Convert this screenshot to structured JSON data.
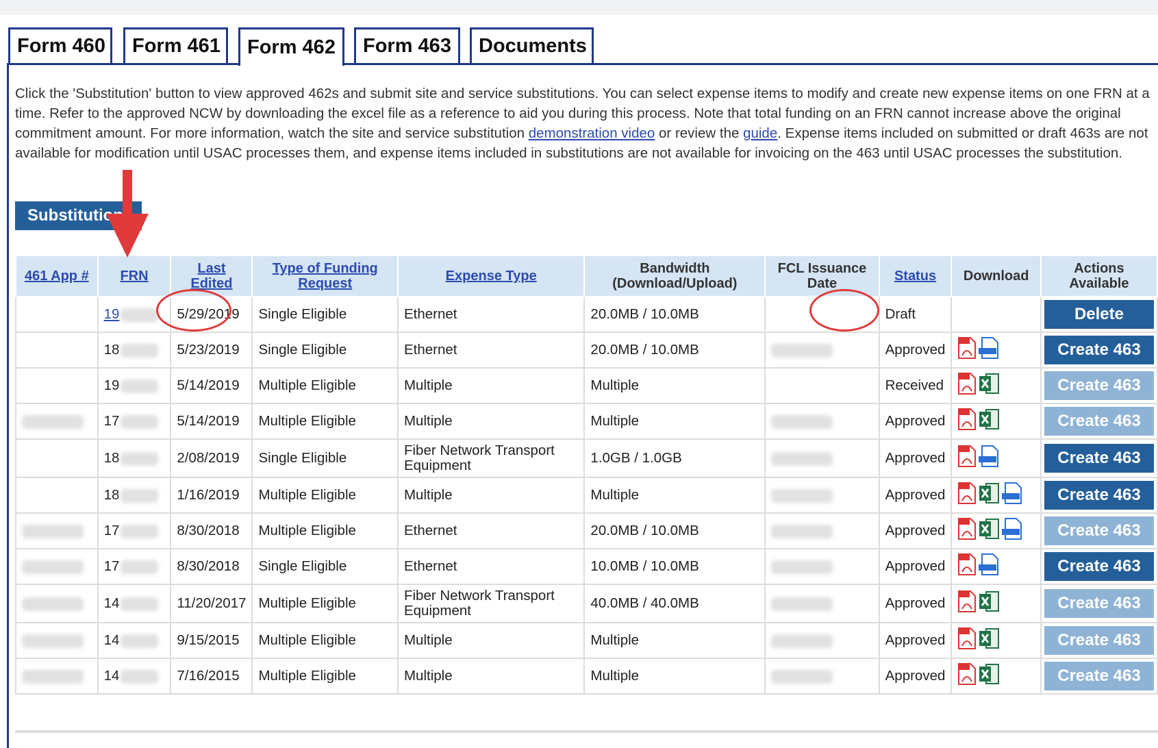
{
  "tabs": [
    {
      "label": "Form 460",
      "active": false
    },
    {
      "label": "Form 461",
      "active": false
    },
    {
      "label": "Form 462",
      "active": true
    },
    {
      "label": "Form 463",
      "active": false
    },
    {
      "label": "Documents",
      "active": false
    }
  ],
  "intro": {
    "text1": "Click the 'Substitution' button to view approved 462s and submit site and service substitutions. You can select expense items to modify and create new expense items on one FRN at a time. Refer to the approved NCW by downloading the excel file as a reference to aid you during this process. Note that total funding on an FRN cannot increase above the original commitment amount. For more information, watch the site and service substitution ",
    "link1": "demonstration video",
    "text2": " or review the ",
    "link2": "guide",
    "text3": ". Expense items included on submitted or draft 463s are not available for modification until USAC processes them, and expense items included in substitutions are not available for invoicing on the 463 until USAC processes the substitution."
  },
  "substitution_button": "Substitution",
  "table": {
    "headers": {
      "app": "461 App #",
      "frn": "FRN",
      "last_edited_1": "Last",
      "last_edited_2": "Edited",
      "funding_1": "Type of Funding",
      "funding_2": "Request",
      "expense": "Expense Type",
      "bandwidth_1": "Bandwidth",
      "bandwidth_2": "(Download/Upload)",
      "fcl_1": "FCL Issuance",
      "fcl_2": "Date",
      "status": "Status",
      "download": "Download",
      "actions_1": "Actions",
      "actions_2": "Available"
    },
    "rows": [
      {
        "frn": "19",
        "edited": "5/29/2019",
        "funding": "Single Eligible",
        "expense": "Ethernet",
        "bw": "20.0MB / 10.0MB",
        "status": "Draft",
        "action": "Delete"
      },
      {
        "frn": "18",
        "edited": "5/23/2019",
        "funding": "Single Eligible",
        "expense": "Ethernet",
        "bw": "20.0MB / 10.0MB",
        "status": "Approved",
        "action": "Create 463"
      },
      {
        "frn": "19",
        "edited": "5/14/2019",
        "funding": "Multiple Eligible",
        "expense": "Multiple",
        "bw": "Multiple",
        "status": "Received",
        "action": "Create 463"
      },
      {
        "frn": "17",
        "edited": "5/14/2019",
        "funding": "Multiple Eligible",
        "expense": "Multiple",
        "bw": "Multiple",
        "status": "Approved",
        "action": "Create 463"
      },
      {
        "frn": "18",
        "edited": "2/08/2019",
        "funding": "Single Eligible",
        "expense": "Fiber Network Transport Equipment",
        "bw": "1.0GB / 1.0GB",
        "status": "Approved",
        "action": "Create 463"
      },
      {
        "frn": "18",
        "edited": "1/16/2019",
        "funding": "Multiple Eligible",
        "expense": "Multiple",
        "bw": "Multiple",
        "status": "Approved",
        "action": "Create 463"
      },
      {
        "frn": "17",
        "edited": "8/30/2018",
        "funding": "Multiple Eligible",
        "expense": "Ethernet",
        "bw": "20.0MB / 10.0MB",
        "status": "Approved",
        "action": "Create 463"
      },
      {
        "frn": "17",
        "edited": "8/30/2018",
        "funding": "Single Eligible",
        "expense": "Ethernet",
        "bw": "10.0MB / 10.0MB",
        "status": "Approved",
        "action": "Create 463"
      },
      {
        "frn": "14",
        "edited": "11/20/2017",
        "funding": "Multiple Eligible",
        "expense": "Fiber Network Transport Equipment",
        "bw": "40.0MB / 40.0MB",
        "status": "Approved",
        "action": "Create 463"
      },
      {
        "frn": "14",
        "edited": "9/15/2015",
        "funding": "Multiple Eligible",
        "expense": "Multiple",
        "bw": "Multiple",
        "status": "Approved",
        "action": "Create 463"
      },
      {
        "frn": "14",
        "edited": "7/16/2015",
        "funding": "Multiple Eligible",
        "expense": "Multiple",
        "bw": "Multiple",
        "status": "Approved",
        "action": "Create 463"
      }
    ]
  },
  "icons": {
    "pdf": "pdf-file-icon",
    "excel": "excel-file-icon",
    "html": "html-file-icon"
  },
  "colors": {
    "brand": "#245f9a",
    "disabled": "#8fb3d5",
    "link": "#2c4bb0",
    "highlight": "#e03a3a"
  }
}
